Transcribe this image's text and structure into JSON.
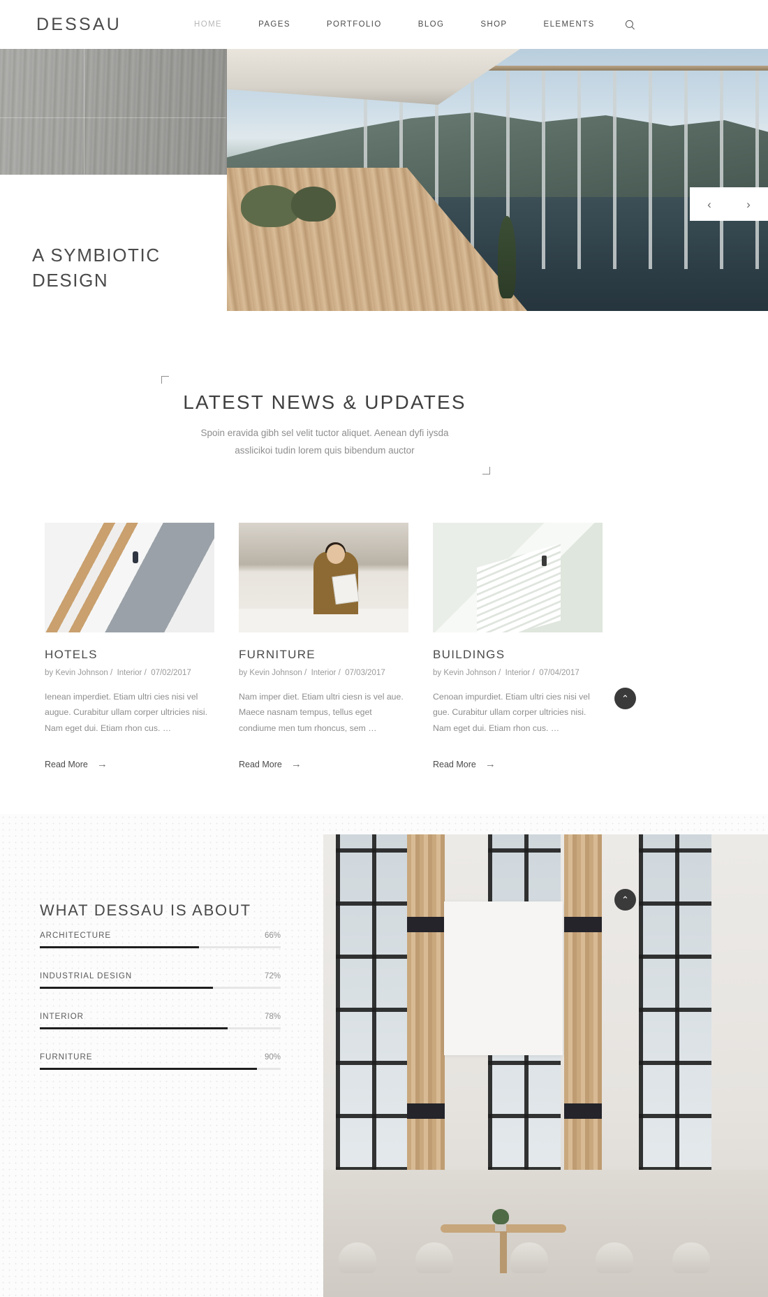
{
  "header": {
    "brand": "DESSAU",
    "nav": [
      {
        "label": "HOME",
        "active": true
      },
      {
        "label": "PAGES",
        "active": false
      },
      {
        "label": "PORTFOLIO",
        "active": false
      },
      {
        "label": "BLOG",
        "active": false
      },
      {
        "label": "SHOP",
        "active": false
      },
      {
        "label": "ELEMENTS",
        "active": false
      }
    ],
    "search_icon": "search-icon"
  },
  "hero": {
    "title_line1": "A SYMBIOTIC",
    "title_line2": "DESIGN",
    "plus_label": "+",
    "prev_label": "‹",
    "next_label": "›"
  },
  "news": {
    "title": "LATEST NEWS & UPDATES",
    "subtitle_line1": "Spoin eravida gibh sel velit tuctor aliquet. Aenean dyfi iysda",
    "subtitle_line2": "asslicikoi tudin lorem quis bibendum auctor",
    "cards": [
      {
        "title": "HOTELS",
        "author": "by Kevin Johnson",
        "category": "Interior",
        "date": "07/02/2017",
        "excerpt": "Ienean imperdiet. Etiam ultri cies nisi vel augue. Curabitur ullam corper ultricies nisi. Nam eget dui. Etiam rhon cus. …",
        "more": "Read More",
        "image": "staircase-photo"
      },
      {
        "title": "FURNITURE",
        "author": "by Kevin Johnson",
        "category": "Interior",
        "date": "07/03/2017",
        "excerpt": "Nam imper diet. Etiam ultri ciesn is vel aue. Maece nasnam tempus, tellus eget condiume men tum rhoncus, sem …",
        "more": "Read More",
        "image": "man-reading-photo"
      },
      {
        "title": "BUILDINGS",
        "author": "by Kevin Johnson",
        "category": "Interior",
        "date": "07/04/2017",
        "excerpt": "Cenoan impurdiet. Etiam ultri cies nisi vel gue. Curabitur ullam corper ultricies nisi. Nam eget dui. Etiam rhon cus. …",
        "more": "Read More",
        "image": "stairs-walker-photo"
      }
    ],
    "separator": "/"
  },
  "about": {
    "title": "WHAT DESSAU IS ABOUT",
    "skills": [
      {
        "name": "ARCHITECTURE",
        "percent_label": "66%",
        "percent": 66
      },
      {
        "name": "INDUSTRIAL DESIGN",
        "percent_label": "72%",
        "percent": 72
      },
      {
        "name": "INTERIOR",
        "percent_label": "78%",
        "percent": 78
      },
      {
        "name": "FURNITURE",
        "percent_label": "90%",
        "percent": 90
      }
    ],
    "image": "interior-room-photo"
  },
  "floating": {
    "scroll_top_label": "⌃"
  },
  "colors": {
    "accent_dark": "#1e1e1e",
    "text": "#4a4a4a",
    "muted": "#8e8e8e",
    "track": "#e6e6e6",
    "page_bg": "#ffffff",
    "about_bg": "#fcfcfc"
  }
}
